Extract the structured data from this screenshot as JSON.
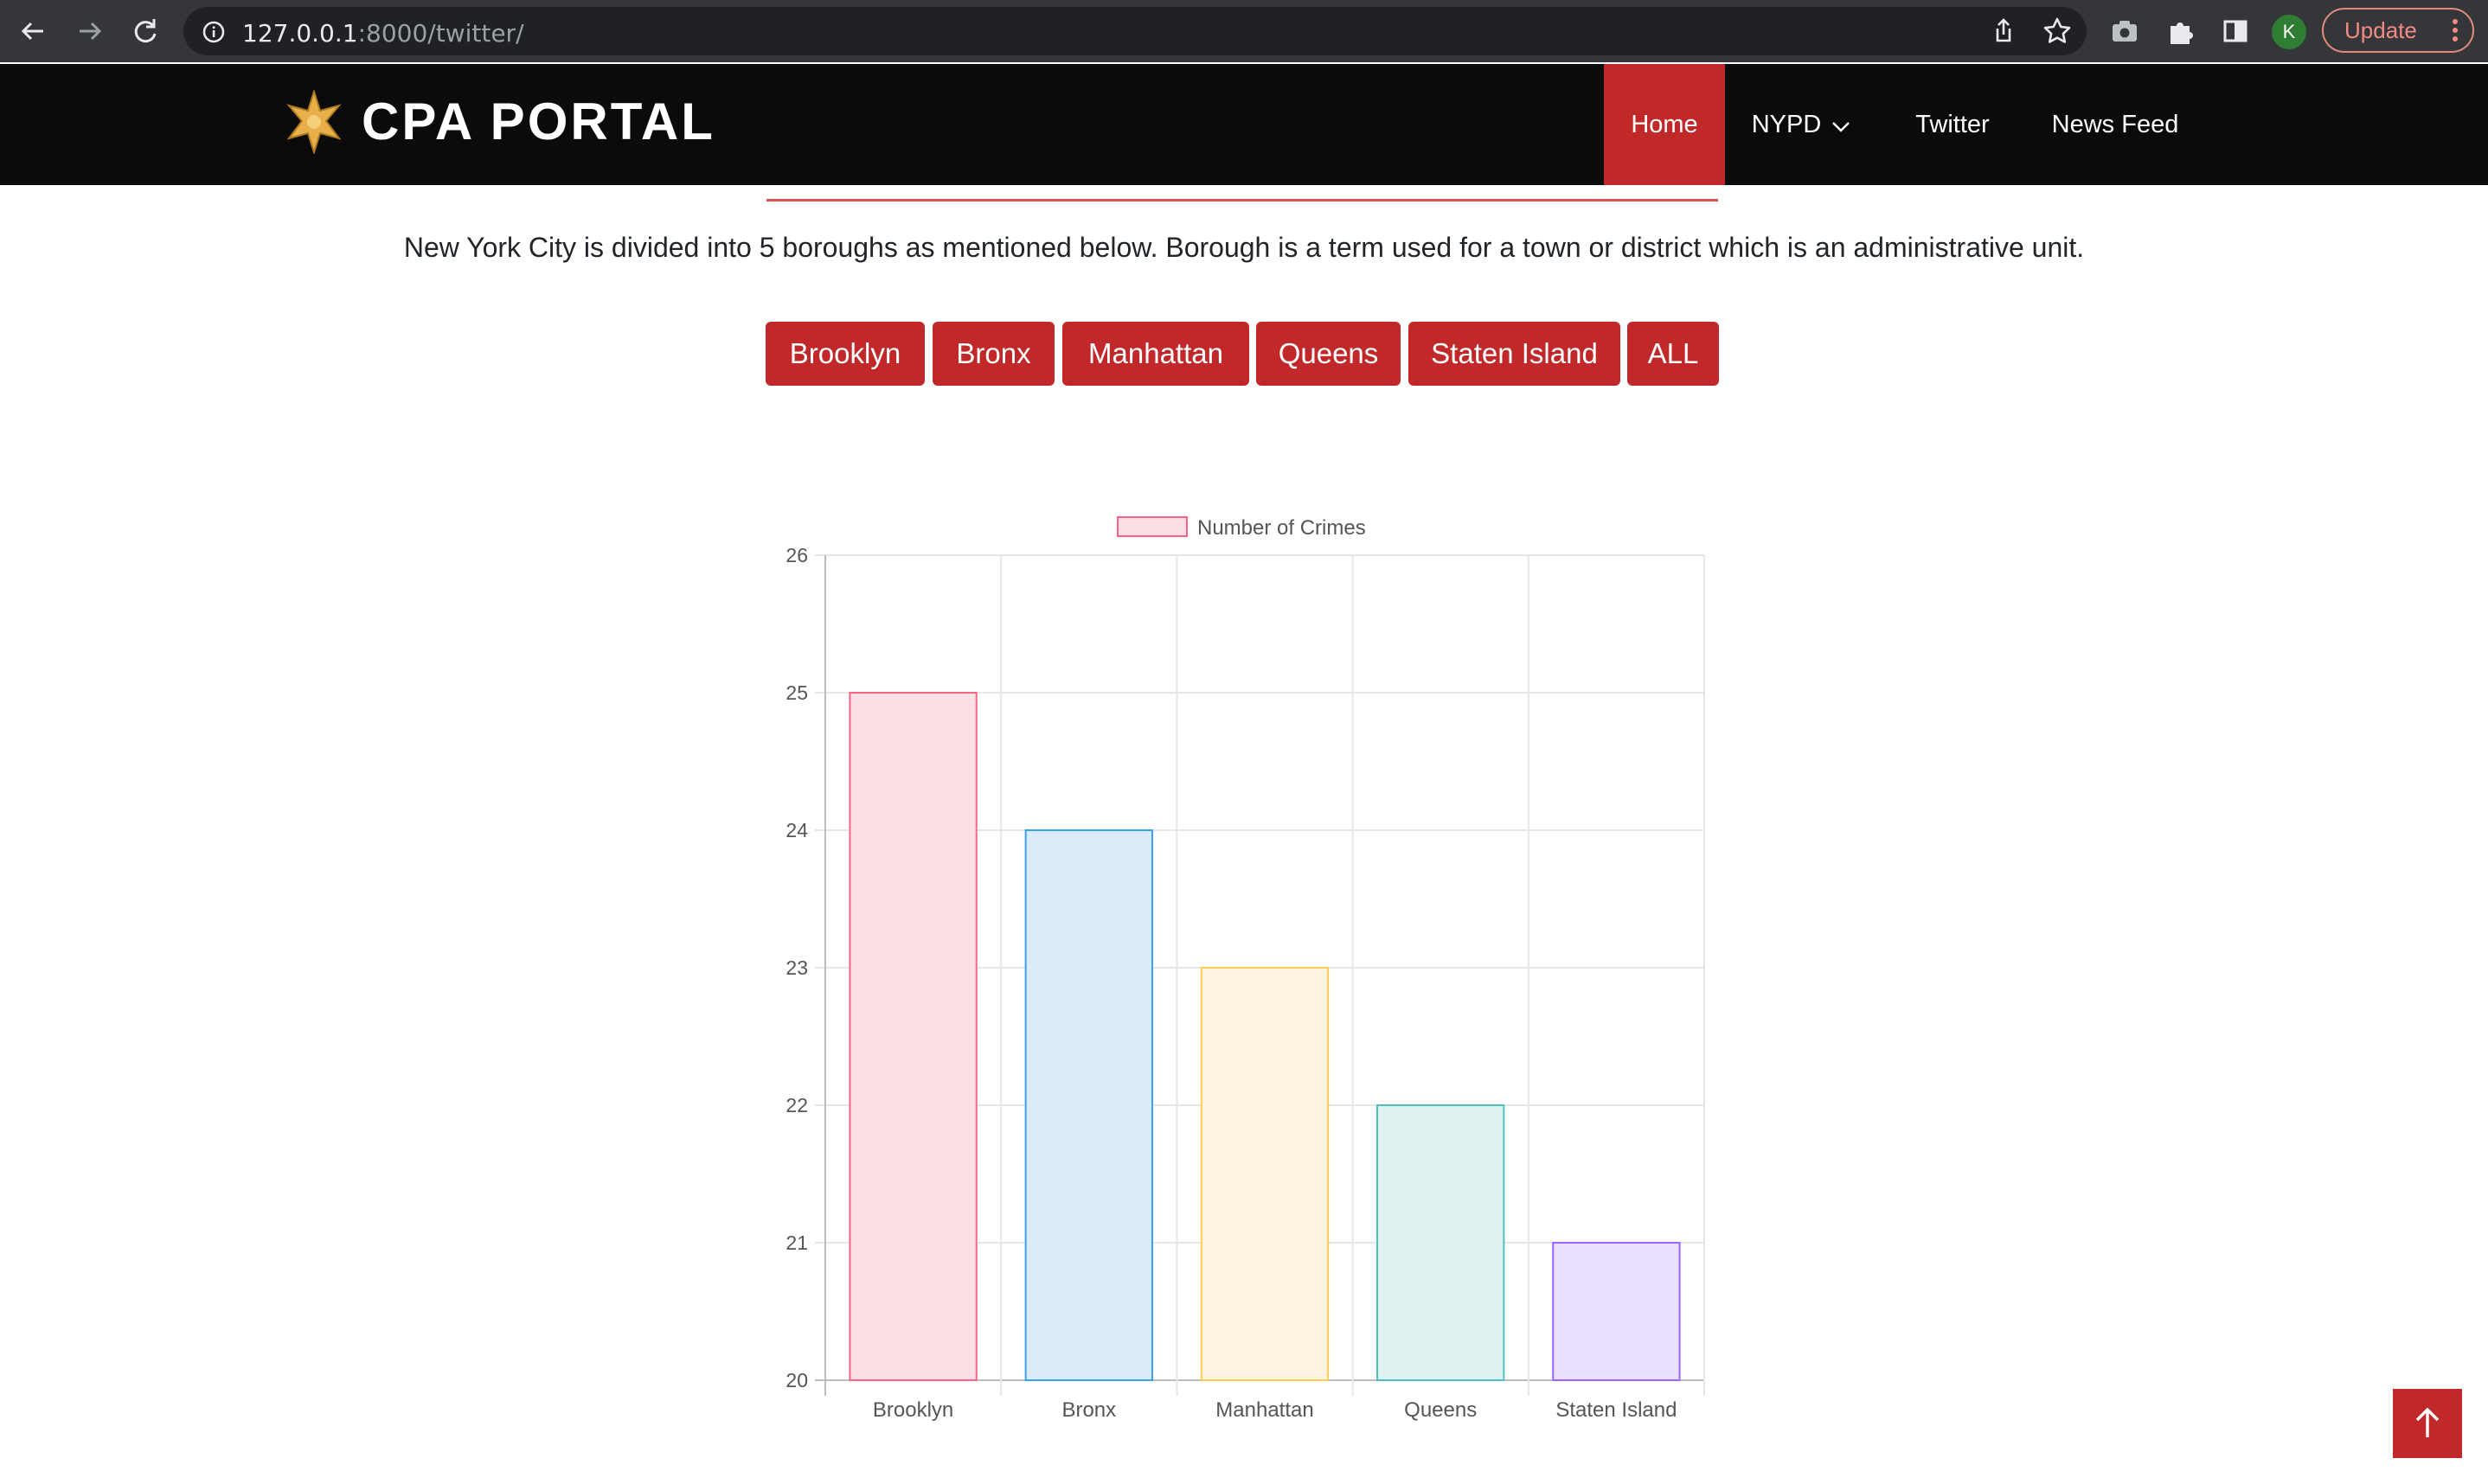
{
  "browser": {
    "url_host": "127.0.0.1",
    "url_rest": ":8000/twitter/",
    "avatar_letter": "K",
    "update_label": "Update"
  },
  "site": {
    "brand": "CPA PORTAL",
    "nav": [
      {
        "label": "Home",
        "active": true
      },
      {
        "label": "NYPD",
        "dropdown": true
      },
      {
        "label": "Twitter"
      },
      {
        "label": "News Feed"
      }
    ]
  },
  "intro_text": "New York City is divided into 5 boroughs as mentioned below. Borough is a term used for a town or district which is an administrative unit.",
  "borough_buttons": [
    "Brooklyn",
    "Bronx",
    "Manhattan",
    "Queens",
    "Staten Island",
    "ALL"
  ],
  "chart_data": {
    "type": "bar",
    "categories": [
      "Brooklyn",
      "Bronx",
      "Manhattan",
      "Queens",
      "Staten Island"
    ],
    "series": [
      {
        "name": "Number of Crimes",
        "values": [
          25,
          24,
          23,
          22,
          21
        ]
      }
    ],
    "ylim": [
      20,
      26
    ],
    "yticks": [
      "20",
      "21",
      "22",
      "23",
      "24",
      "25",
      "26"
    ],
    "legend": "top",
    "grid": true,
    "bar_fill_colors": [
      "#fbe0e6",
      "#dbebfa",
      "#fdf4e0",
      "#dff2f2",
      "#ebe0ff"
    ],
    "bar_border_colors": [
      "#ff6384",
      "#36a2eb",
      "#ffcd56",
      "#4bc0c0",
      "#9966ff"
    ],
    "legend_fill": "#fbe0e6",
    "legend_border": "#ff6384"
  },
  "colors": {
    "accent": "#c0282a",
    "navbar_bg": "#0b0b0b"
  },
  "icons": {
    "back": "back-arrow-icon",
    "forward": "forward-arrow-icon",
    "reload": "reload-icon",
    "info": "info-icon",
    "share": "share-icon",
    "bookmark": "star-icon",
    "camera": "camera-icon",
    "extensions": "puzzle-icon",
    "sidepanel": "side-panel-icon",
    "logo": "sheriff-star-icon",
    "scroll_top": "arrow-up-icon"
  }
}
